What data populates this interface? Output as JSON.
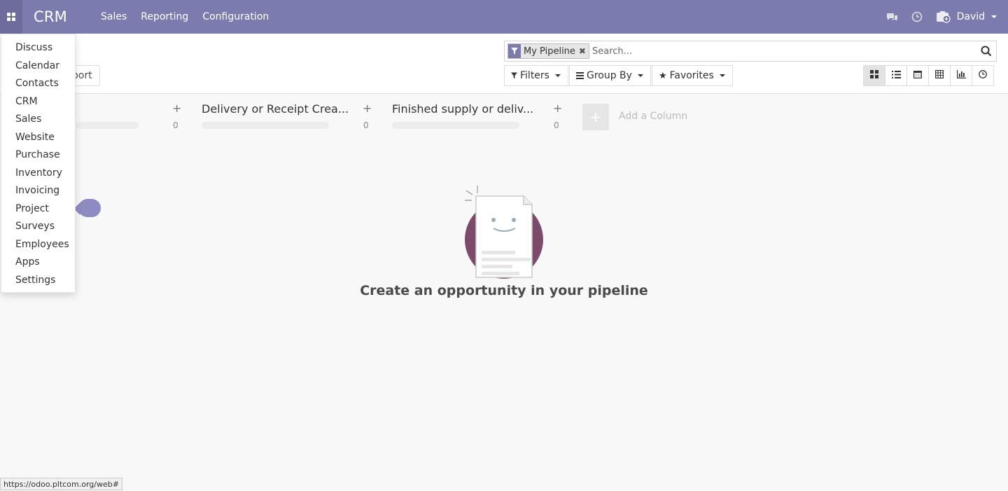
{
  "navbar": {
    "brand": "CRM",
    "menus": [
      "Sales",
      "Reporting",
      "Configuration"
    ],
    "user": "David",
    "color": "#7c7bad"
  },
  "control_panel": {
    "import_label": "port",
    "search": {
      "facet_value": "My Pipeline",
      "placeholder": "Search..."
    },
    "filters_label": "Filters",
    "group_by_label": "Group By",
    "favorites_label": "Favorites",
    "views": [
      "kanban-icon",
      "list-icon",
      "calendar-icon",
      "pivot-icon",
      "graph-icon",
      "activity-icon"
    ]
  },
  "kanban": {
    "columns": [
      {
        "title": "",
        "count": "0"
      },
      {
        "title": "Delivery or Receipt Crea...",
        "count": "0"
      },
      {
        "title": "Finished supply or deliv...",
        "count": "0"
      }
    ],
    "add_column_label": "Add a Column"
  },
  "helper": {
    "title": "Create an opportunity in your pipeline"
  },
  "apps_menu": {
    "items": [
      "Discuss",
      "Calendar",
      "Contacts",
      "CRM",
      "Sales",
      "Website",
      "Purchase",
      "Inventory",
      "Invoicing",
      "Project",
      "Surveys",
      "Employees",
      "Apps",
      "Settings"
    ]
  },
  "status_bar": {
    "url": "https://odoo.pltcom.org/web#"
  }
}
